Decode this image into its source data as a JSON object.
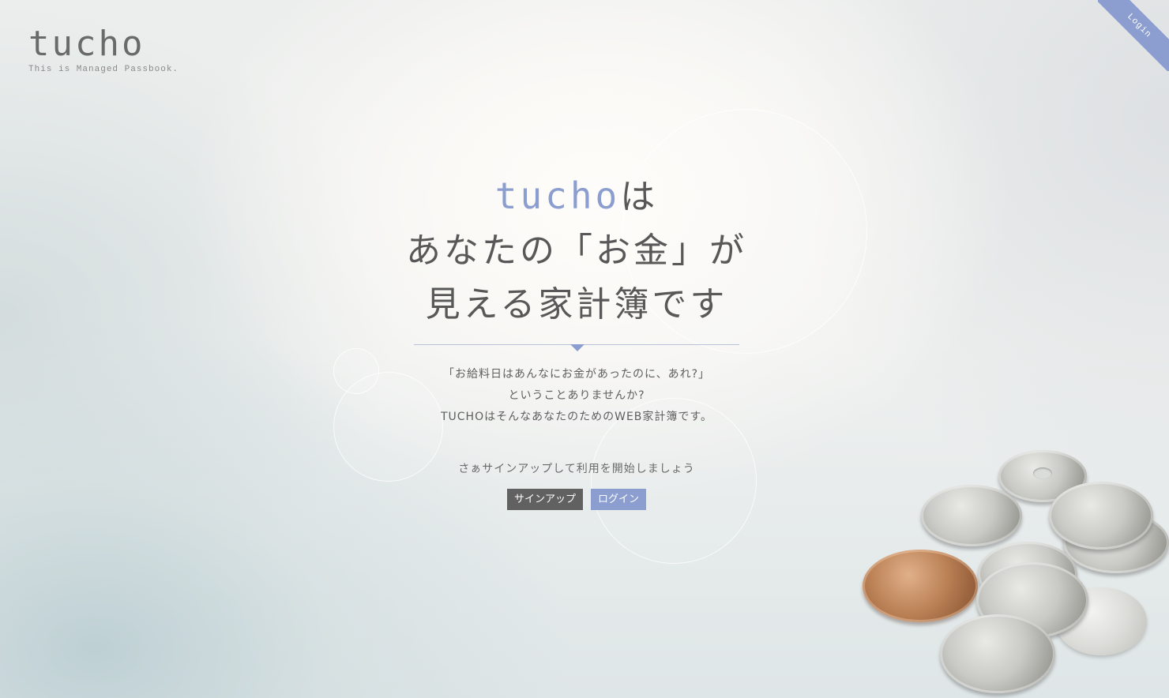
{
  "brand": {
    "logo": "tucho",
    "tagline": "This is Managed Passbook."
  },
  "corner_login": {
    "label": "Login"
  },
  "hero": {
    "headline_brand": "tucho",
    "headline_line1_suffix": "は",
    "headline_line2": "あなたの「お金」が",
    "headline_line3": "見える家計簿です",
    "intro_lines": [
      "「お給料日はあんなにお金があったのに、あれ?」",
      "ということありませんか?",
      "TUCHOはそんなあなたのためのWEB家計簿です。"
    ],
    "cta_text": "さぁサインアップして利用を開始しましょう"
  },
  "buttons": {
    "signup_label": "サインアップ",
    "login_label": "ログイン"
  },
  "colors": {
    "accent": "#8b9ecf",
    "signup_button": "#616161",
    "text": "#585858"
  },
  "images": {
    "background_photo": "coins-on-table"
  }
}
